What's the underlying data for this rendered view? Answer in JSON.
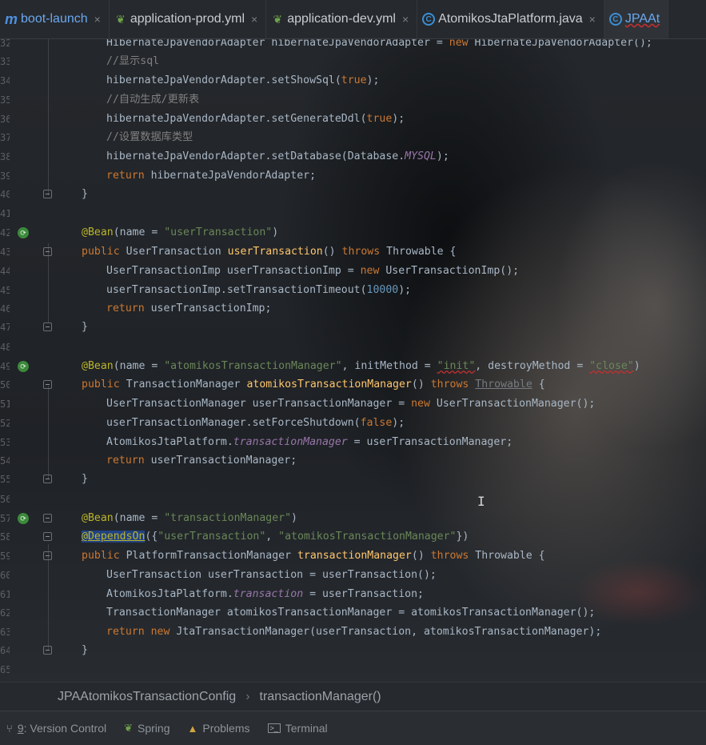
{
  "tabs": [
    {
      "icon": "maven-icon",
      "icon_glyph": "m",
      "label": "boot-launch",
      "close": "×"
    },
    {
      "icon": "spring-yml-icon",
      "icon_glyph": "❦",
      "label": "application-prod.yml",
      "close": "×"
    },
    {
      "icon": "spring-yml-icon",
      "icon_glyph": "❦",
      "label": "application-dev.yml",
      "close": "×"
    },
    {
      "icon": "java-class-icon",
      "icon_glyph": "C",
      "label": "AtomikosJtaPlatform.java",
      "close": "×"
    },
    {
      "icon": "java-class-icon",
      "icon_glyph": "C",
      "label": "JPAAt",
      "close": ""
    }
  ],
  "line_numbers": [
    "32",
    "33",
    "34",
    "35",
    "36",
    "37",
    "38",
    "39",
    "40",
    "41",
    "42",
    "43",
    "44",
    "45",
    "46",
    "47",
    "48",
    "49",
    "50",
    "51",
    "52",
    "53",
    "54",
    "55",
    "56",
    "57",
    "58",
    "59",
    "60",
    "61",
    "62",
    "63",
    "64",
    "65"
  ],
  "code": {
    "l32": "HibernateJpaVendorAdapter hibernateJpaVendorAdapter = ",
    "l32_new": "new",
    "l32_end": " HibernateJpaVendorAdapter();",
    "l33": "//显示sql",
    "l34a": "hibernateJpaVendorAdapter.setShowSql(",
    "l34b": "true",
    "l34c": ");",
    "l35": "//自动生成/更新表",
    "l36a": "hibernateJpaVendorAdapter.setGenerateDdl(",
    "l36b": "true",
    "l36c": ");",
    "l37": "//设置数据库类型",
    "l38a": "hibernateJpaVendorAdapter.setDatabase(Database.",
    "l38b": "MYSQL",
    "l38c": ");",
    "l39a": "return",
    "l39b": " hibernateJpaVendorAdapter;",
    "l40": "}",
    "l42a": "@Bean",
    "l42b": "(name = ",
    "l42c": "\"userTransaction\"",
    "l42d": ")",
    "l43a": "public",
    "l43b": " UserTransaction ",
    "l43c": "userTransaction",
    "l43d": "() ",
    "l43e": "throws",
    "l43f": " Throwable {",
    "l44a": "UserTransactionImp userTransactionImp = ",
    "l44b": "new",
    "l44c": " UserTransactionImp();",
    "l45a": "userTransactionImp.setTransactionTimeout(",
    "l45b": "10000",
    "l45c": ");",
    "l46a": "return",
    "l46b": " userTransactionImp;",
    "l47": "}",
    "l49a": "@Bean",
    "l49b": "(name = ",
    "l49c": "\"atomikosTransactionManager\"",
    "l49d": ", initMethod = ",
    "l49e": "\"init\"",
    "l49f": ", destroyMethod = ",
    "l49g": "\"close\"",
    "l49h": ")",
    "l50a": "public",
    "l50b": " TransactionManager ",
    "l50c": "atomikosTransactionManager",
    "l50d": "() ",
    "l50e": "throws",
    "l50f": " ",
    "l50g": "Throwable",
    "l50h": " {",
    "l51a": "UserTransactionManager userTransactionManager = ",
    "l51b": "new",
    "l51c": " UserTransactionManager();",
    "l52a": "userTransactionManager.setForceShutdown(",
    "l52b": "false",
    "l52c": ");",
    "l53a": "AtomikosJtaPlatform.",
    "l53b": "transactionManager",
    "l53c": " = userTransactionManager;",
    "l54a": "return",
    "l54b": " userTransactionManager;",
    "l55": "}",
    "l57a": "@Bean",
    "l57b": "(name = ",
    "l57c": "\"transactionManager\"",
    "l57d": ")",
    "l58a": "@DependsOn",
    "l58b": "({",
    "l58c": "\"userTransaction\"",
    "l58d": ", ",
    "l58e": "\"atomikosTransactionManager\"",
    "l58f": "})",
    "l59a": "public",
    "l59b": " PlatformTransactionManager ",
    "l59c": "transactionManager",
    "l59d": "() ",
    "l59e": "throws",
    "l59f": " Throwable {",
    "l60": "UserTransaction userTransaction = userTransaction();",
    "l61a": "AtomikosJtaPlatform.",
    "l61b": "transaction",
    "l61c": " = userTransaction;",
    "l62": "TransactionManager atomikosTransactionManager = atomikosTransactionManager();",
    "l63a": "return new",
    "l63b": " JtaTransactionManager(userTransaction, atomikosTransactionManager);",
    "l64": "}"
  },
  "breadcrumb": {
    "class_name": "JPAAtomikosTransactionConfig",
    "separator": "›",
    "method": "transactionManager()"
  },
  "tool_windows": [
    {
      "icon": "version-control-icon",
      "key": "9",
      "label": ": Version Control"
    },
    {
      "icon": "spring-icon",
      "label": "Spring"
    },
    {
      "icon": "warning-icon",
      "label": "Problems"
    },
    {
      "icon": "terminal-icon",
      "label": "Terminal"
    }
  ],
  "colors": {
    "keyword": "#cc7832",
    "annotation": "#bbb529",
    "string": "#6a8759",
    "comment": "#808080",
    "number": "#6897bb",
    "method": "#ffc66d",
    "field": "#9876aa"
  }
}
